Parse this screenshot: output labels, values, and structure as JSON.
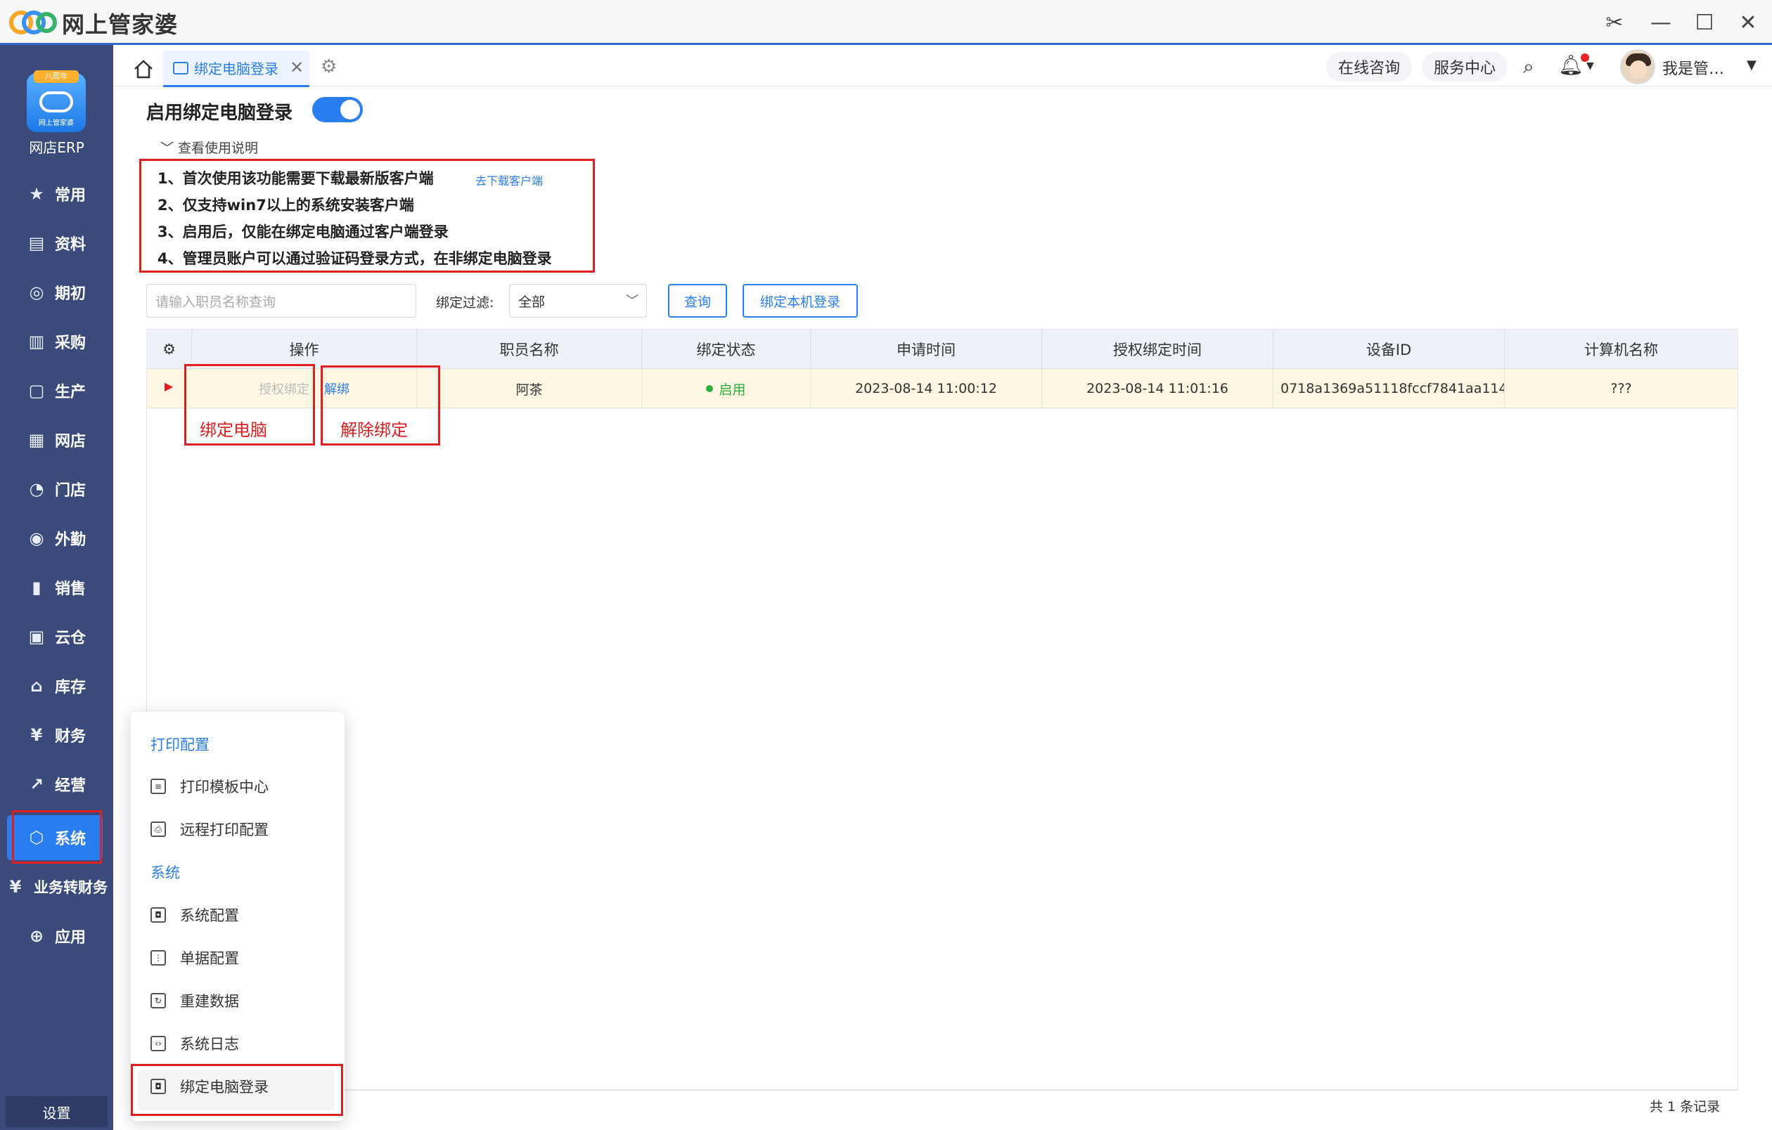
{
  "app": {
    "title": "网上管家婆"
  },
  "sidebar": {
    "logo_badge": "八周年",
    "logo_sub": "网上管家婆",
    "product_name": "网店ERP",
    "items": [
      {
        "label": "常用",
        "icon": "star-icon"
      },
      {
        "label": "资料",
        "icon": "id-card-icon"
      },
      {
        "label": "期初",
        "icon": "target-icon"
      },
      {
        "label": "采购",
        "icon": "purchase-icon"
      },
      {
        "label": "生产",
        "icon": "document-icon"
      },
      {
        "label": "网店",
        "icon": "store-icon"
      },
      {
        "label": "门店",
        "icon": "pie-icon"
      },
      {
        "label": "外勤",
        "icon": "field-icon"
      },
      {
        "label": "销售",
        "icon": "bar-chart-icon"
      },
      {
        "label": "云仓",
        "icon": "cloud-warehouse-icon"
      },
      {
        "label": "库存",
        "icon": "warehouse-icon"
      },
      {
        "label": "财务",
        "icon": "yuan-icon"
      },
      {
        "label": "经营",
        "icon": "trend-icon"
      },
      {
        "label": "系统",
        "icon": "system-icon"
      },
      {
        "label": "业务转财务",
        "icon": "yuan-box-icon"
      },
      {
        "label": "应用",
        "icon": "plus-icon"
      }
    ],
    "active_item": "系统",
    "settings_label": "设置"
  },
  "tabs": {
    "active_label": "绑定电脑登录",
    "online_consult": "在线咨询",
    "service_center": "服务中心",
    "user_name": "我是管…"
  },
  "page": {
    "enable_label": "启用绑定电脑登录",
    "enabled": true,
    "guide_toggle": "查看使用说明",
    "guide_lines": [
      "1、首次使用该功能需要下载最新版客户端",
      "2、仅支持win7以上的系统安装客户端",
      "3、启用后，仅能在绑定电脑通过客户端登录",
      "4、管理员账户可以通过验证码登录方式，在非绑定电脑登录"
    ],
    "download_link": "去下载客户端",
    "search_placeholder": "请输入职员名称查询",
    "filter_label": "绑定过滤:",
    "filter_value": "全部",
    "query_button": "查询",
    "bind_local_button": "绑定本机登录"
  },
  "table": {
    "columns": [
      "操作",
      "职员名称",
      "绑定状态",
      "申请时间",
      "授权绑定时间",
      "设备ID",
      "计算机名称"
    ],
    "rows": [
      {
        "auth_bind": "授权绑定",
        "unbind": "解绑",
        "employee": "阿茶",
        "status": "启用",
        "apply_time": "2023-08-14 11:00:12",
        "bind_time": "2023-08-14 11:01:16",
        "device_id": "0718a1369a51118fccf7841aa114…",
        "computer": "???"
      }
    ],
    "annotations": {
      "bind_pc": "绑定电脑",
      "unbind_pc": "解除绑定"
    },
    "record_count": "共 1 条记录"
  },
  "popup": {
    "group_print": "打印配置",
    "print_items": [
      "打印模板中心",
      "远程打印配置"
    ],
    "group_system": "系统",
    "system_items": [
      "系统配置",
      "单据配置",
      "重建数据",
      "系统日志",
      "绑定电脑登录"
    ]
  },
  "colors": {
    "sidebar": "#3a4a7a",
    "accent": "#2a7ef0",
    "annotation": "#e02020"
  }
}
